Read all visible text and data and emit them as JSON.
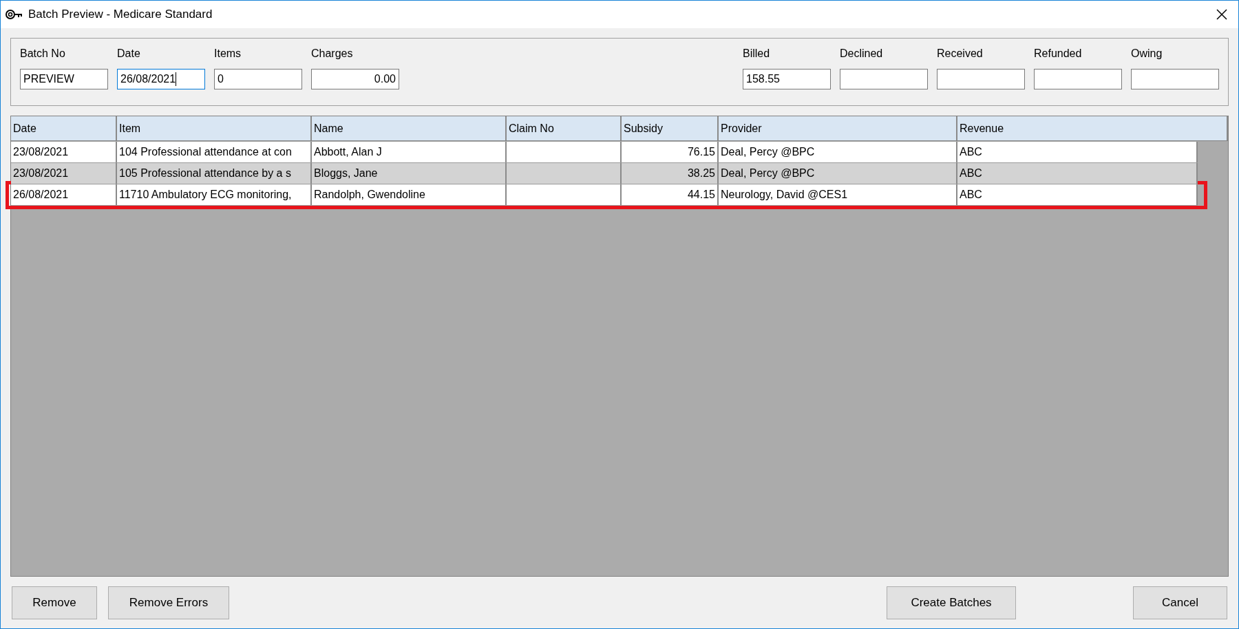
{
  "window": {
    "title": "Batch Preview - Medicare Standard"
  },
  "summary_left": [
    {
      "label": "Batch No",
      "value": "PREVIEW",
      "kind": "text",
      "focused": false
    },
    {
      "label": "Date",
      "value": "26/08/2021",
      "kind": "text",
      "focused": true
    },
    {
      "label": "Items",
      "value": "0",
      "kind": "text",
      "focused": false
    },
    {
      "label": "Charges",
      "value": "0.00",
      "kind": "amount",
      "focused": false
    }
  ],
  "summary_right": [
    {
      "label": "Billed",
      "value": "158.55"
    },
    {
      "label": "Declined"
    },
    {
      "label": "Received"
    },
    {
      "label": "Refunded"
    },
    {
      "label": "Owing"
    }
  ],
  "table": {
    "columns": [
      "Date",
      "Item",
      "Name",
      "Claim No",
      "Subsidy",
      "Provider",
      "Revenue"
    ],
    "rows": [
      {
        "cells": [
          "23/08/2021",
          "104 Professional attendance at con",
          "Abbott, Alan J",
          "",
          "76.15",
          "Deal, Percy @BPC",
          "ABC"
        ],
        "selected": false,
        "highlighted": false
      },
      {
        "cells": [
          "23/08/2021",
          "105 Professional attendance by a s",
          "Bloggs, Jane",
          "",
          "38.25",
          "Deal, Percy @BPC",
          "ABC"
        ],
        "selected": true,
        "highlighted": false
      },
      {
        "cells": [
          "26/08/2021",
          "11710 Ambulatory ECG monitoring,",
          "Randolph, Gwendoline",
          "",
          "44.15",
          "Neurology, David @CES1",
          "ABC"
        ],
        "selected": false,
        "highlighted": true
      }
    ]
  },
  "buttons_left": [
    "Remove",
    "Remove Errors"
  ],
  "buttons_right": [
    "Create Batches",
    "Cancel"
  ]
}
